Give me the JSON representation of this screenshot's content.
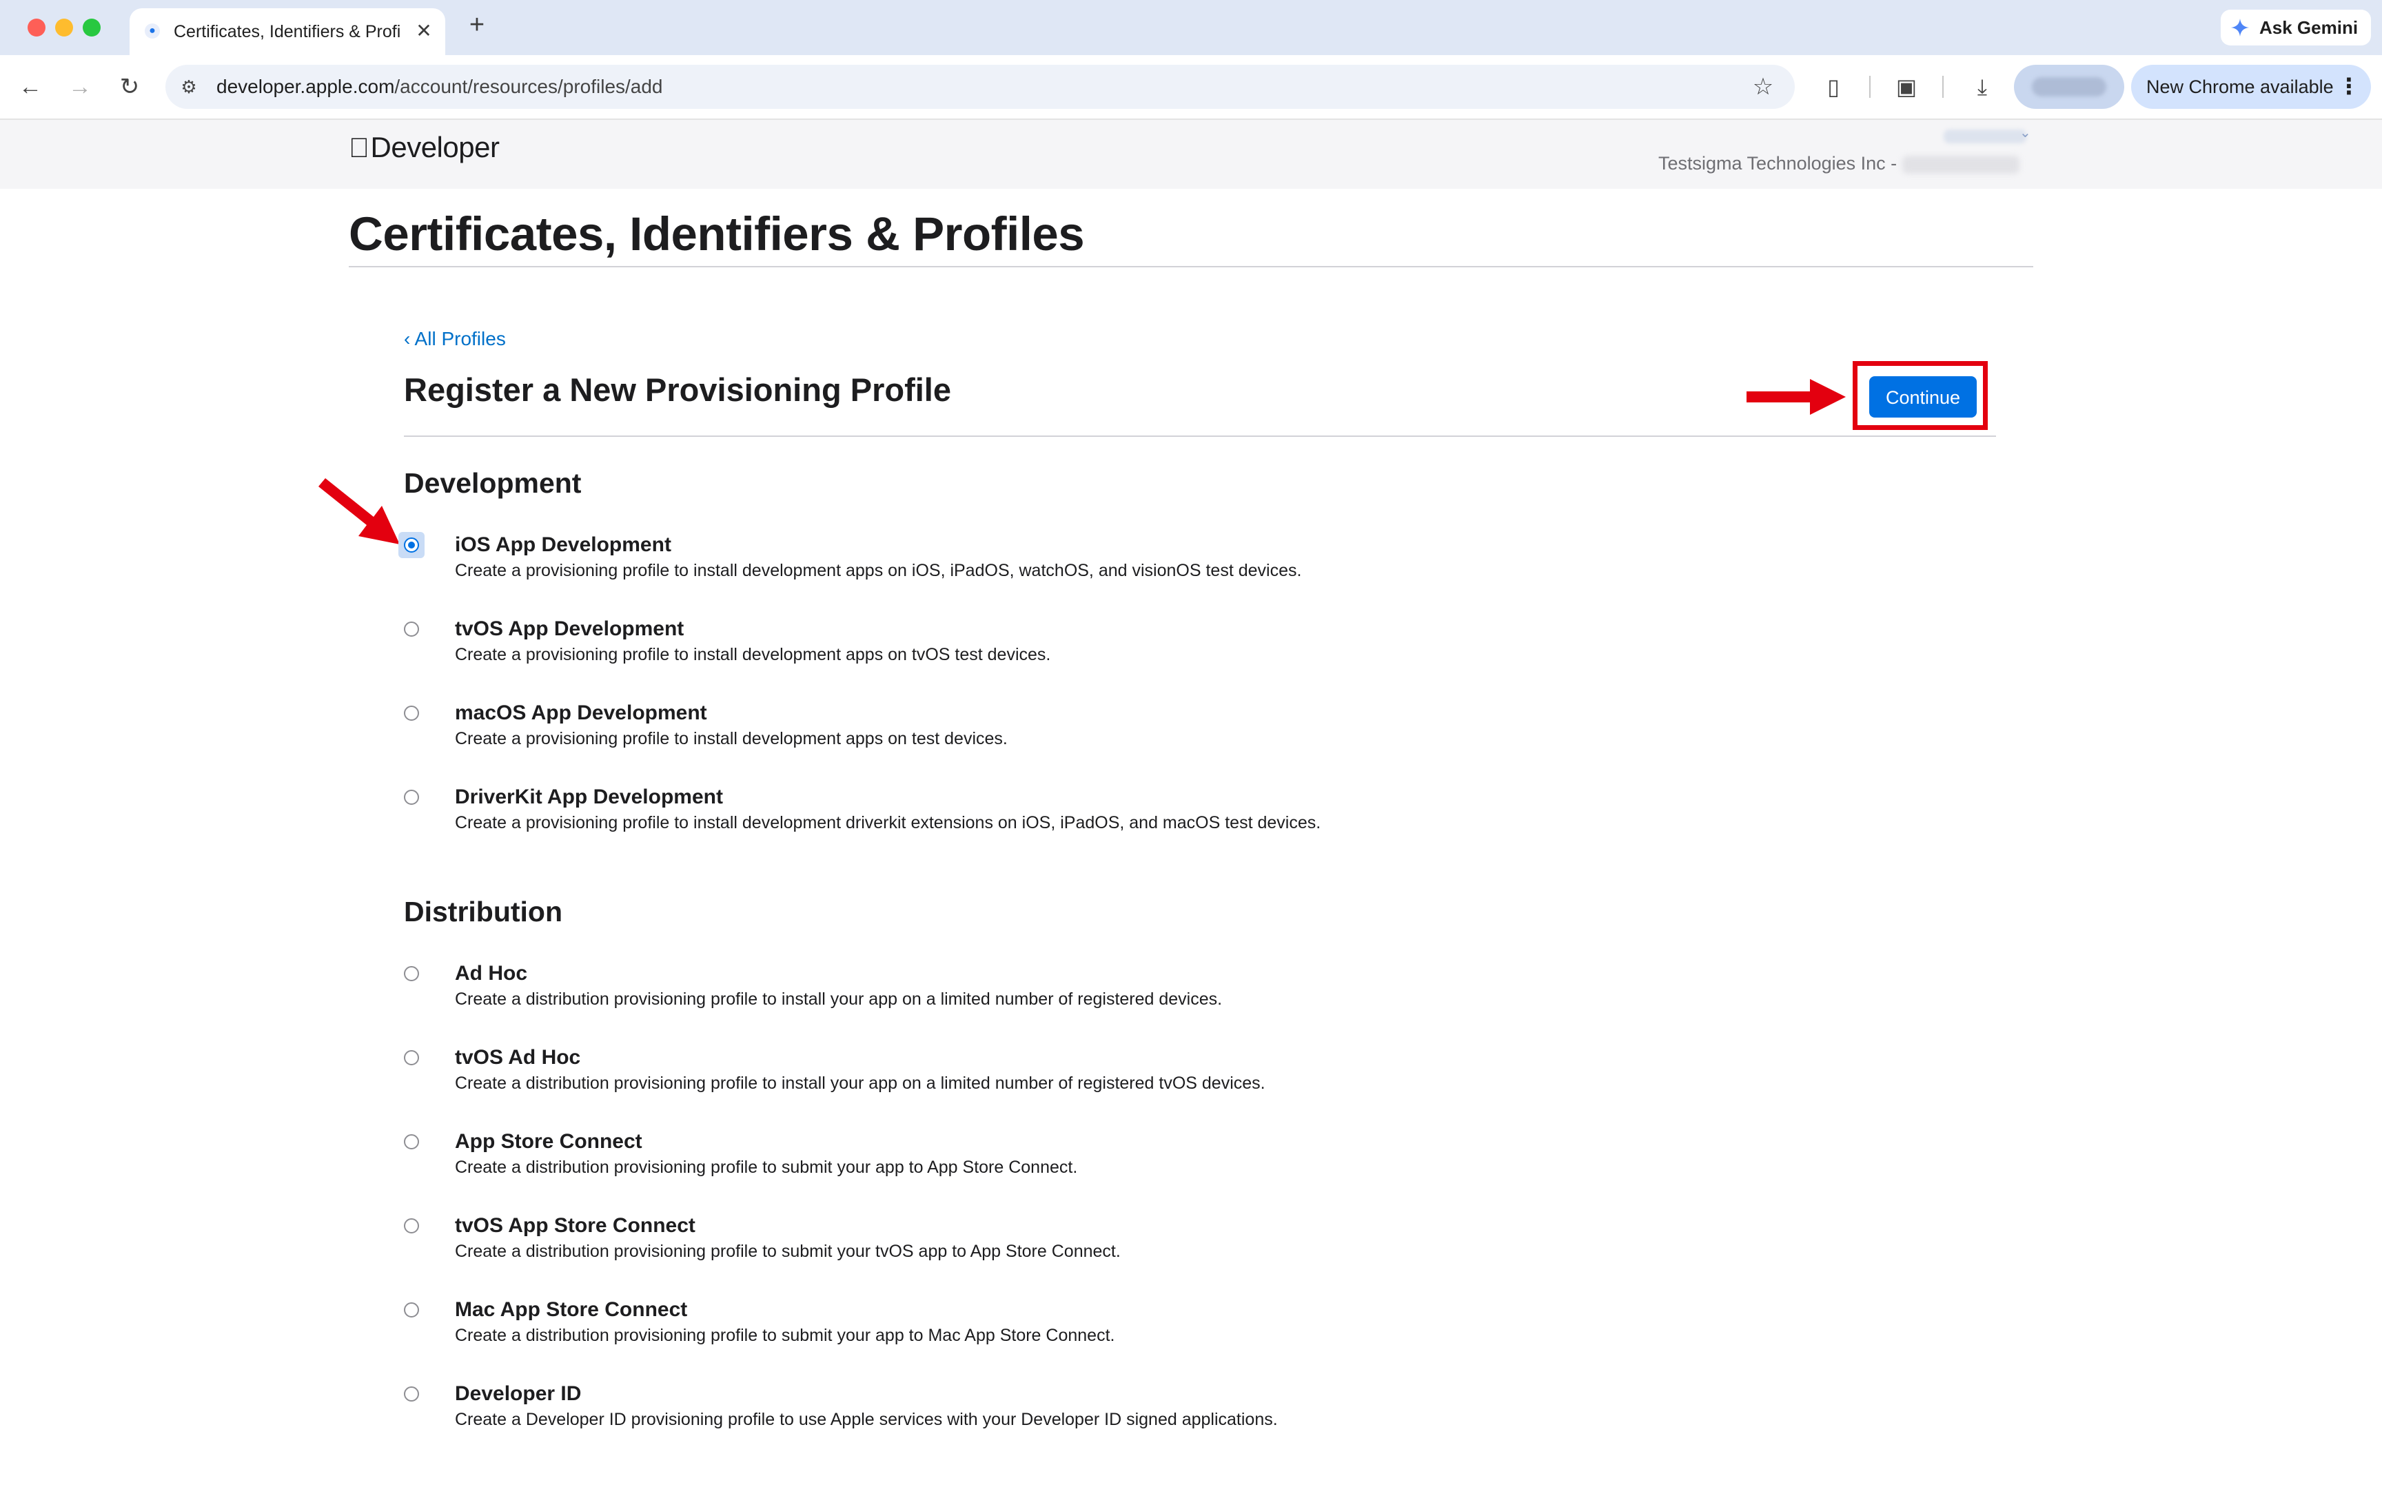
{
  "browser": {
    "tab_title": "Certificates, Identifiers & Profiles",
    "new_tab_label": "+",
    "ask_gemini": "Ask Gemini",
    "url_host": "developer.apple.com",
    "url_path": "/account/resources/profiles/add",
    "update_label": "New Chrome available"
  },
  "site": {
    "logo_text": "Developer",
    "team_name": "Testsigma Technologies Inc -"
  },
  "page": {
    "title": "Certificates, Identifiers & Profiles",
    "back_link": "‹ All Profiles",
    "section_title": "Register a New Provisioning Profile",
    "continue_label": "Continue"
  },
  "development": {
    "heading": "Development",
    "options": [
      {
        "label": "iOS App Development",
        "desc": "Create a provisioning profile to install development apps on iOS, iPadOS, watchOS, and visionOS test devices.",
        "checked": true
      },
      {
        "label": "tvOS App Development",
        "desc": "Create a provisioning profile to install development apps on tvOS test devices.",
        "checked": false
      },
      {
        "label": "macOS App Development",
        "desc": "Create a provisioning profile to install development apps on test devices.",
        "checked": false
      },
      {
        "label": "DriverKit App Development",
        "desc": "Create a provisioning profile to install development driverkit extensions on iOS, iPadOS, and macOS test devices.",
        "checked": false
      }
    ]
  },
  "distribution": {
    "heading": "Distribution",
    "options": [
      {
        "label": "Ad Hoc",
        "desc": "Create a distribution provisioning profile to install your app on a limited number of registered devices.",
        "checked": false
      },
      {
        "label": "tvOS Ad Hoc",
        "desc": "Create a distribution provisioning profile to install your app on a limited number of registered tvOS devices.",
        "checked": false
      },
      {
        "label": "App Store Connect",
        "desc": "Create a distribution provisioning profile to submit your app to App Store Connect.",
        "checked": false
      },
      {
        "label": "tvOS App Store Connect",
        "desc": "Create a distribution provisioning profile to submit your tvOS app to App Store Connect.",
        "checked": false
      },
      {
        "label": "Mac App Store Connect",
        "desc": "Create a distribution provisioning profile to submit your app to Mac App Store Connect.",
        "checked": false
      },
      {
        "label": "Developer ID",
        "desc": "Create a Developer ID provisioning profile to use Apple services with your Developer ID signed applications.",
        "checked": false
      }
    ]
  },
  "colors": {
    "accent": "#0071e3",
    "link": "#0070c9",
    "annotation": "#e3000f"
  }
}
